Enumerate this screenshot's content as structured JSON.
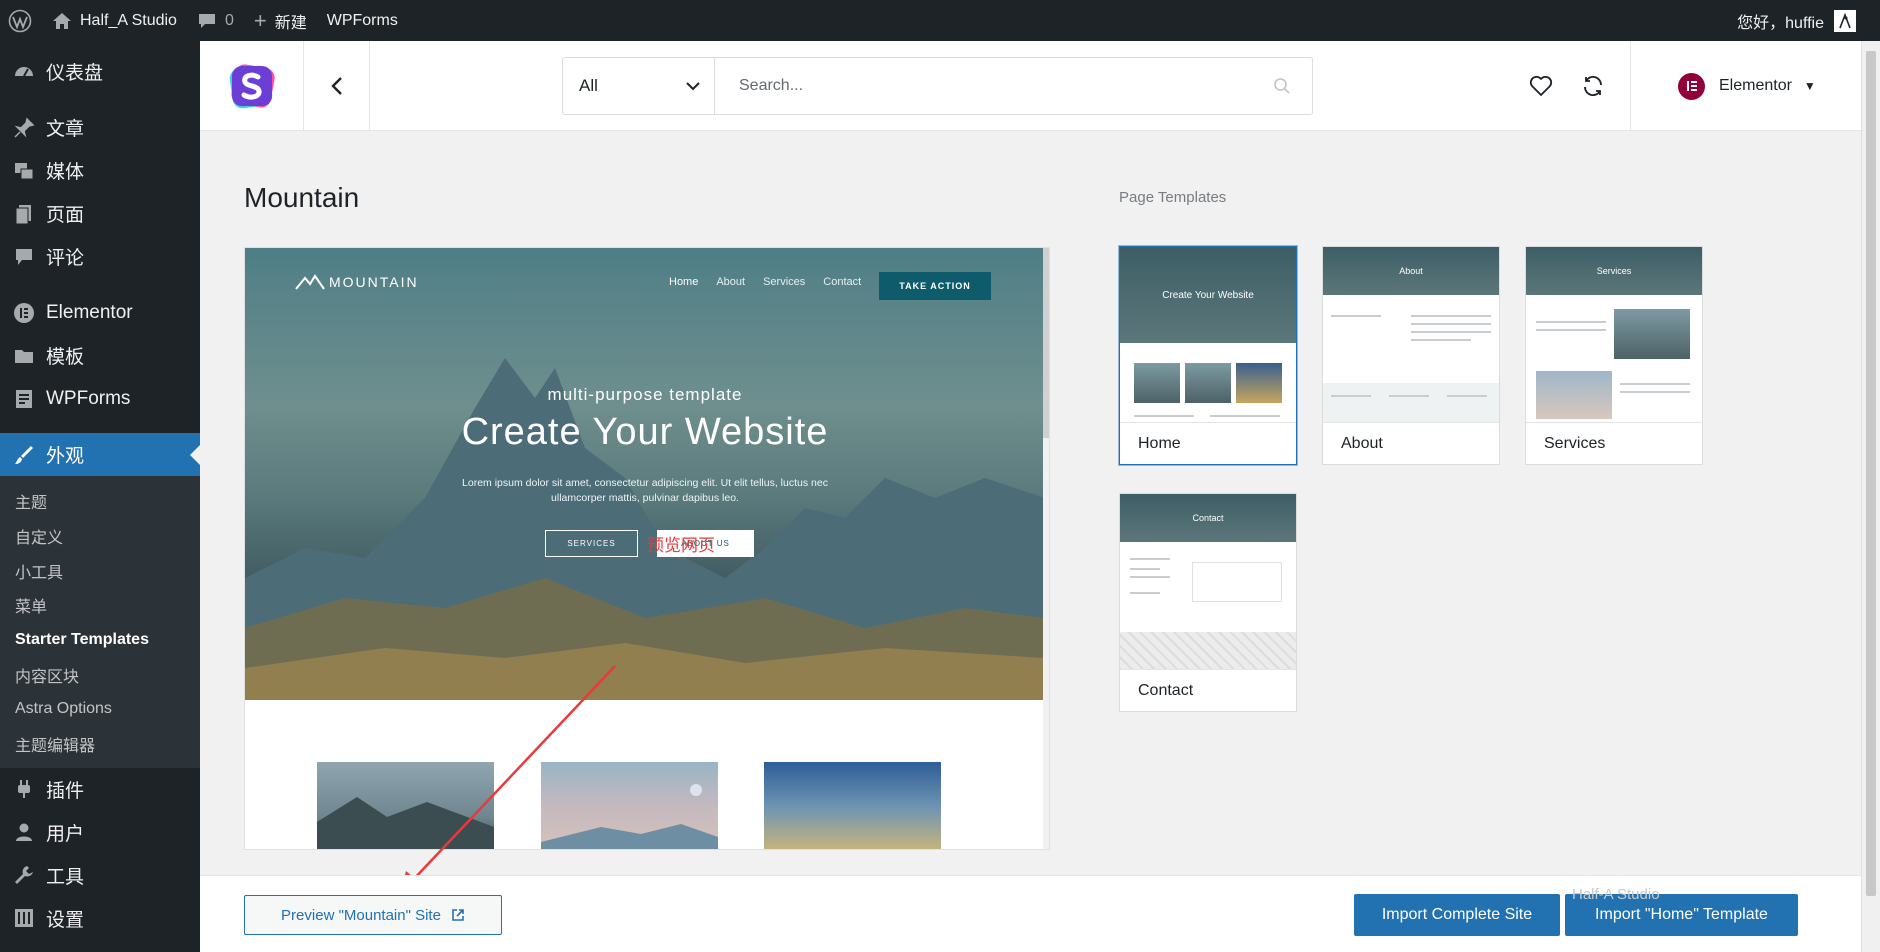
{
  "adminbar": {
    "site_name": "Half_A Studio",
    "comments_count": "0",
    "new_label": "新建",
    "wpforms_label": "WPForms",
    "greeting": "您好，huffie"
  },
  "sidebar": {
    "items": [
      {
        "label": "仪表盘",
        "icon": "dashboard-icon"
      },
      {
        "label": "文章",
        "icon": "pin-icon"
      },
      {
        "label": "媒体",
        "icon": "media-icon"
      },
      {
        "label": "页面",
        "icon": "page-icon"
      },
      {
        "label": "评论",
        "icon": "comment-icon"
      },
      {
        "label": "Elementor",
        "icon": "elementor-icon"
      },
      {
        "label": "模板",
        "icon": "folder-icon"
      },
      {
        "label": "WPForms",
        "icon": "wpforms-icon"
      },
      {
        "label": "外观",
        "icon": "brush-icon"
      }
    ],
    "submenu": [
      "主题",
      "自定义",
      "小工具",
      "菜单",
      "Starter Templates",
      "内容区块",
      "Astra Options",
      "主题编辑器"
    ],
    "bottom_items": [
      {
        "label": "插件",
        "icon": "plugin-icon"
      },
      {
        "label": "用户",
        "icon": "user-icon"
      },
      {
        "label": "工具",
        "icon": "wrench-icon"
      },
      {
        "label": "设置",
        "icon": "settings-icon"
      }
    ]
  },
  "toolbar": {
    "filter_value": "All",
    "search_placeholder": "Search...",
    "builder_label": "Elementor"
  },
  "site": {
    "title": "Mountain"
  },
  "preview": {
    "logo_text": "MOUNTAIN",
    "nav_links": [
      "Home",
      "About",
      "Services",
      "Contact"
    ],
    "cta": "TAKE ACTION",
    "subtitle": "multi-purpose template",
    "headline": "Create Your Website",
    "description": "Lorem ipsum dolor sit amet, consectetur adipiscing elit. Ut elit tellus, luctus nec ullamcorper mattis, pulvinar dapibus leo.",
    "btn_services": "SERVICES",
    "btn_about": "ABOUT US"
  },
  "annotation": {
    "text": "预览网页",
    "color": "#e83a3a"
  },
  "page_templates": {
    "heading": "Page Templates",
    "items": [
      {
        "name": "Home",
        "hero": "Create Your Website"
      },
      {
        "name": "About",
        "hero": "About"
      },
      {
        "name": "Services",
        "hero": "Services"
      },
      {
        "name": "Contact",
        "hero": "Contact"
      }
    ]
  },
  "footer": {
    "preview_label": "Preview \"Mountain\" Site",
    "import_site_label": "Import Complete Site",
    "import_template_label": "Import \"Home\" Template"
  },
  "watermark": "Half-A Studio",
  "colors": {
    "accent": "#2271b1",
    "admin_dark": "#1d2327",
    "annotation_red": "#e83a3a"
  }
}
